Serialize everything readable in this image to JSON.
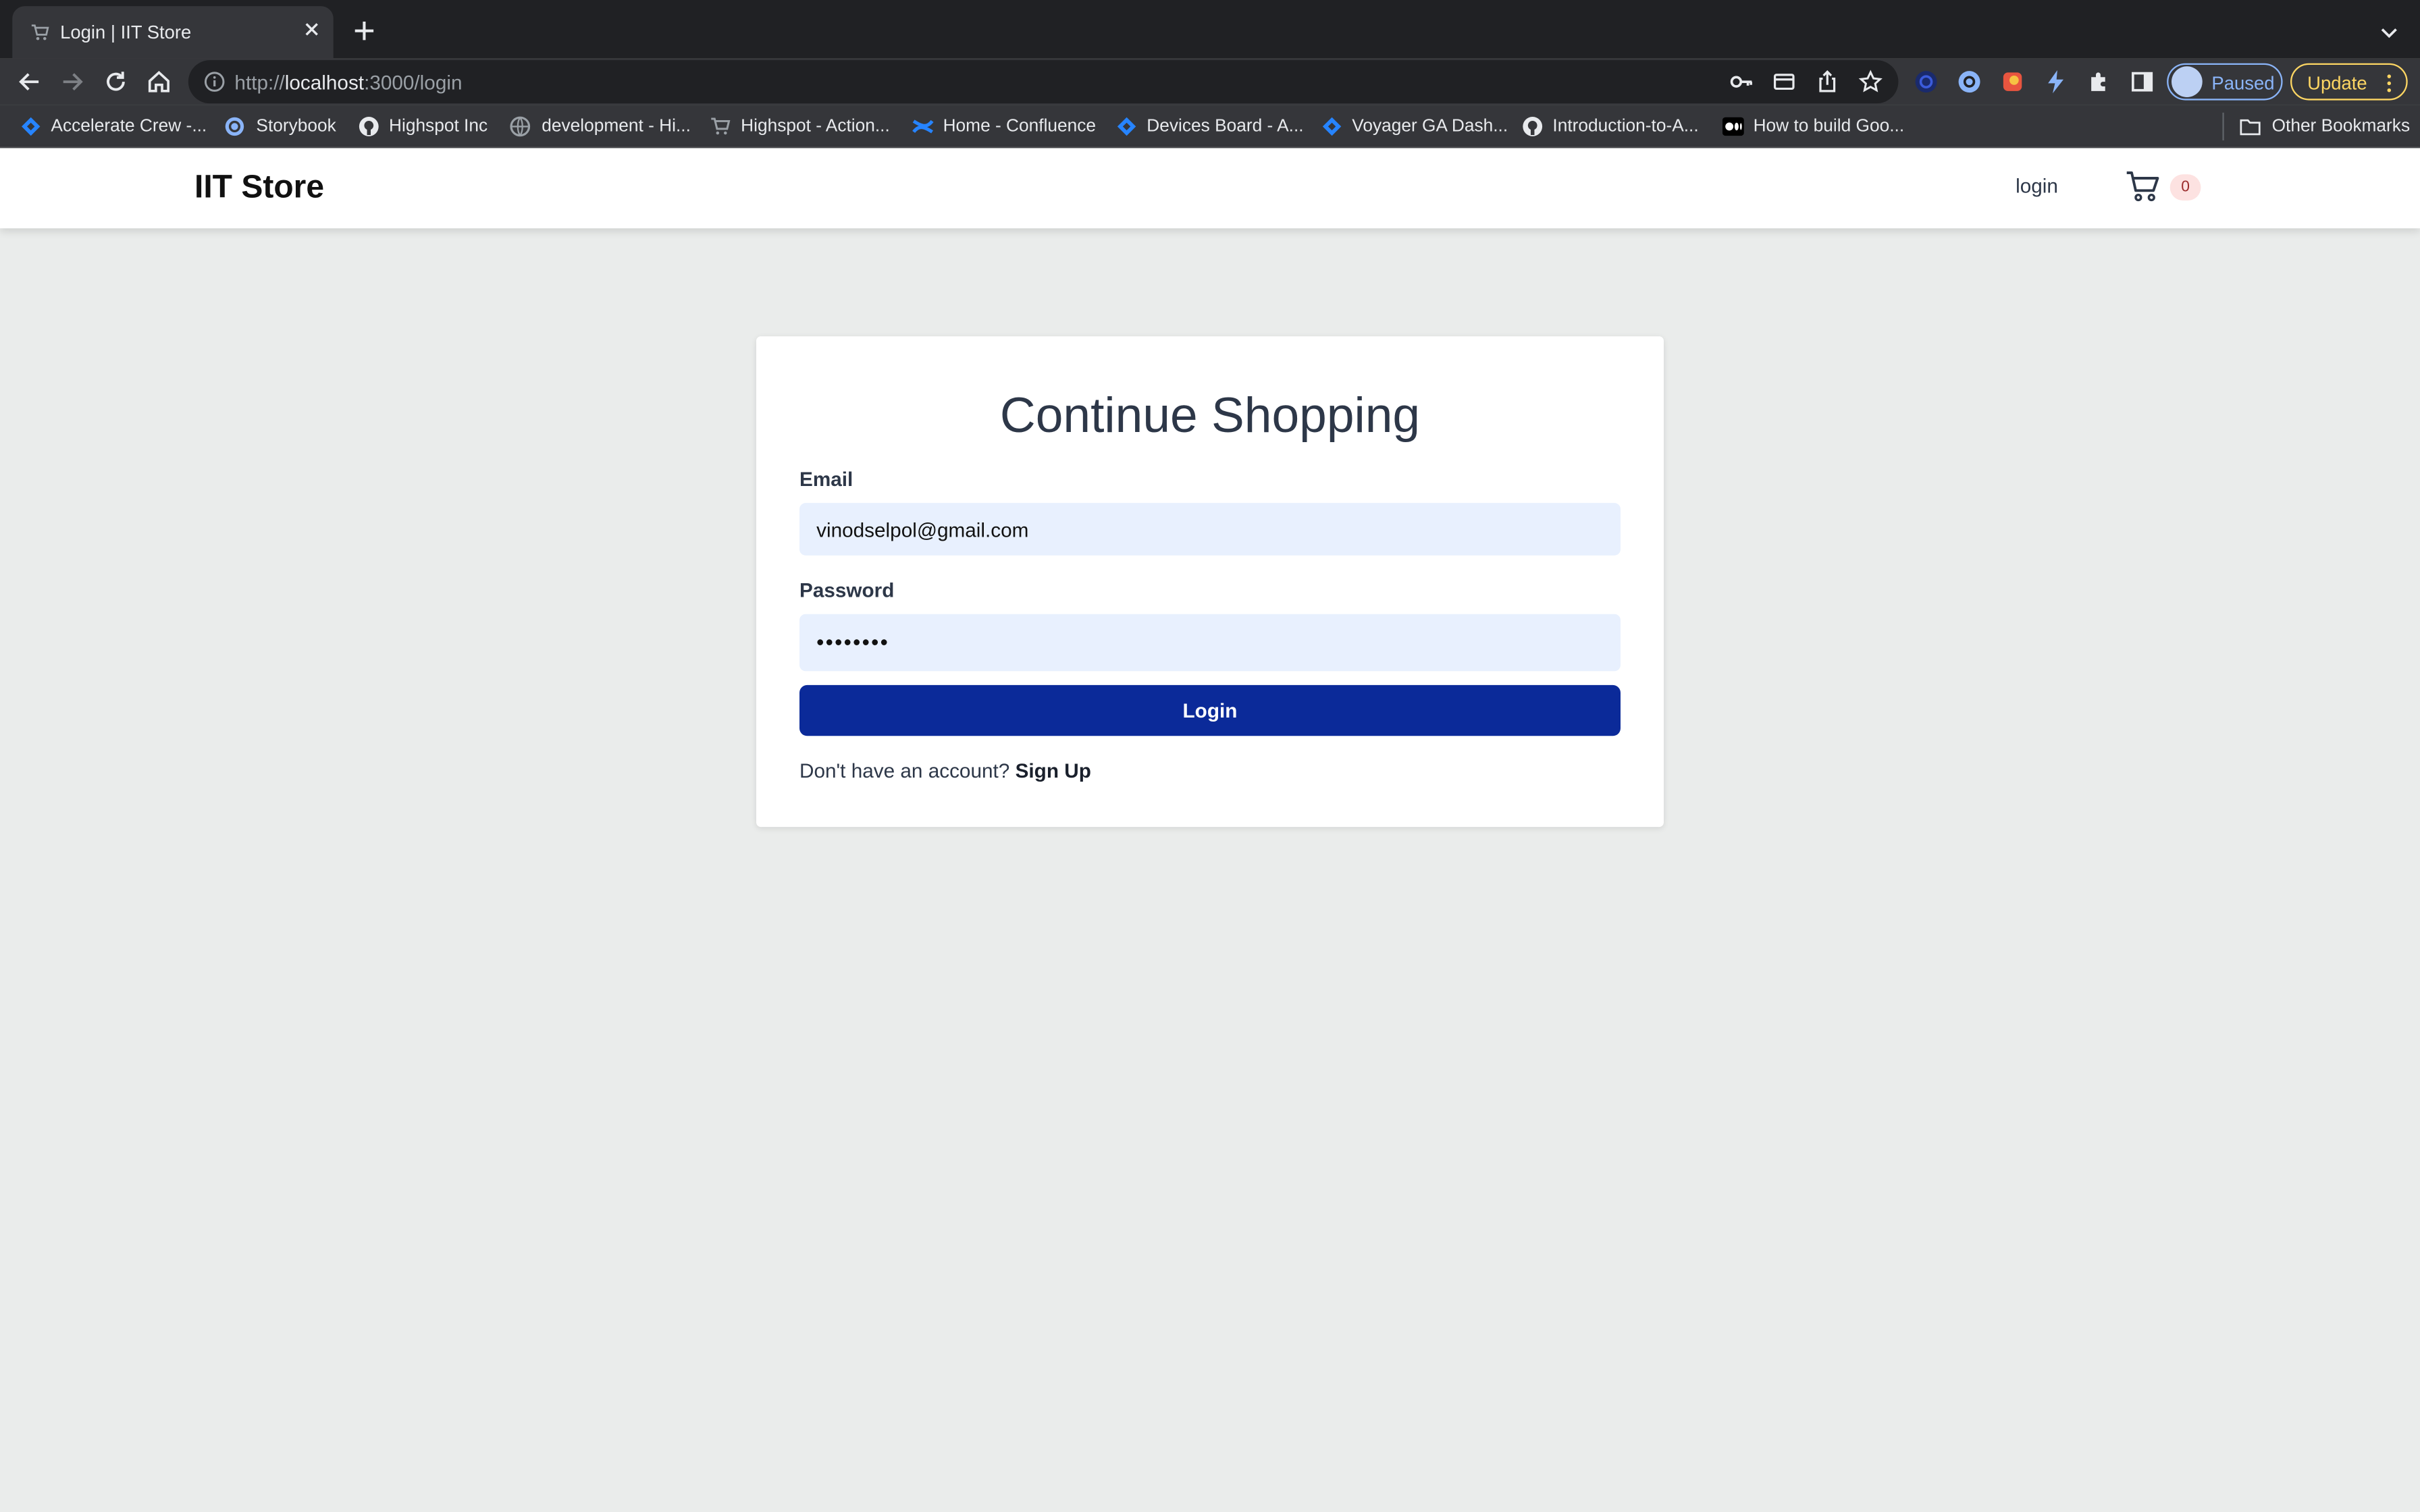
{
  "browser": {
    "tab": {
      "title": "Login | IIT Store"
    },
    "url": {
      "scheme": "http://",
      "host": "localhost",
      "rest": ":3000/login"
    },
    "profile": {
      "label": "Paused"
    },
    "update": {
      "label": "Update"
    },
    "bookmarks": [
      {
        "label": "Accelerate Crew -...",
        "icon": "jira-icon"
      },
      {
        "label": "Storybook",
        "icon": "storybook-icon"
      },
      {
        "label": "Highspot Inc",
        "icon": "github-icon"
      },
      {
        "label": "development - Hi...",
        "icon": "globe-icon"
      },
      {
        "label": "Highspot - Action...",
        "icon": "cart-icon"
      },
      {
        "label": "Home - Confluence",
        "icon": "confluence-icon"
      },
      {
        "label": "Devices Board - A...",
        "icon": "jira-icon"
      },
      {
        "label": "Voyager GA Dash...",
        "icon": "jira-icon"
      },
      {
        "label": "Introduction-to-A...",
        "icon": "github-icon"
      },
      {
        "label": "How to build Goo...",
        "icon": "medium-icon"
      }
    ],
    "other_bookmarks": {
      "label": "Other Bookmarks"
    }
  },
  "navbar": {
    "brand": "IIT Store",
    "login_link": "login",
    "cart_count": "0"
  },
  "login_form": {
    "title": "Continue Shopping",
    "email_label": "Email",
    "email_value": "vinodselpol@gmail.com",
    "password_label": "Password",
    "password_value": "••••••••",
    "submit_label": "Login",
    "signup_prompt": "Don't have an account?",
    "signup_link": "Sign Up"
  },
  "colors": {
    "page_bg": "#eaeceb",
    "primary_button": "#0b2a99",
    "input_bg": "#e8f0fe",
    "badge_bg": "#fde2e1"
  }
}
